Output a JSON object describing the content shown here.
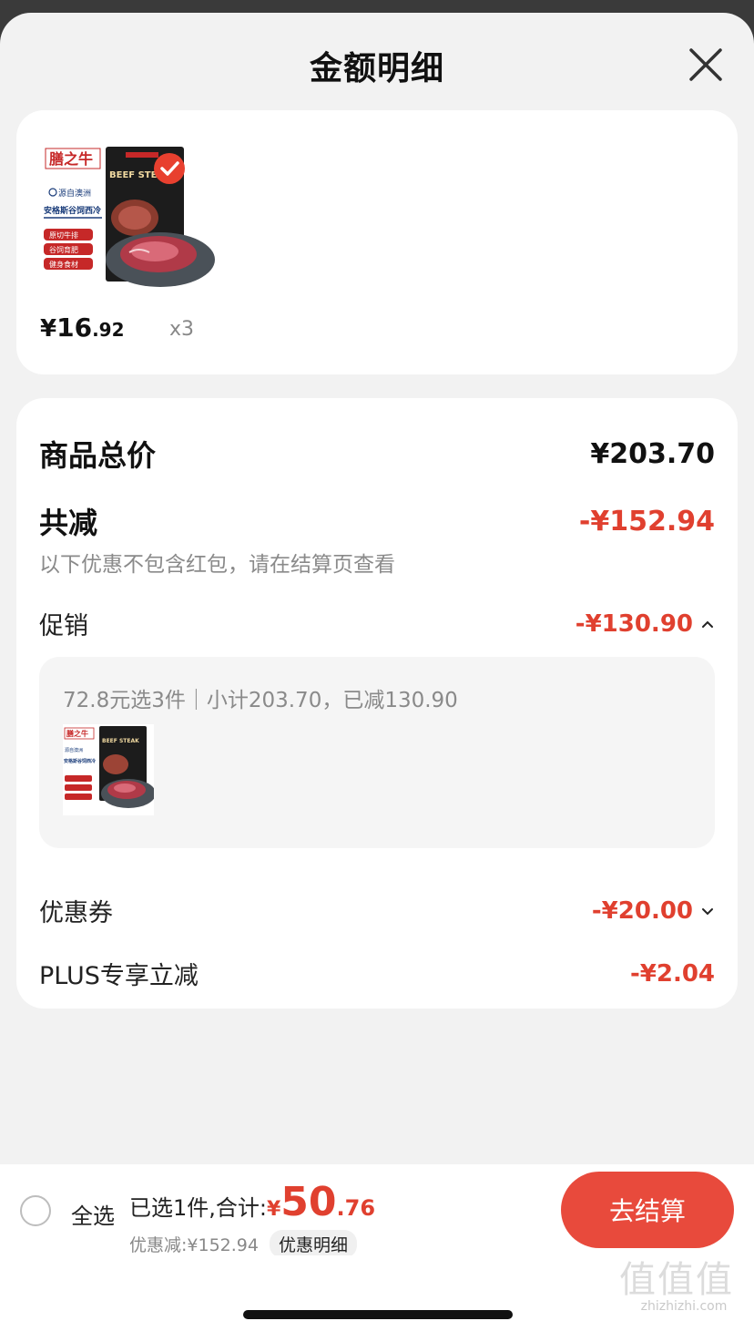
{
  "header": {
    "title": "金额明细"
  },
  "product": {
    "price_currency": "¥",
    "price_int": "16",
    "price_dec": ".92",
    "quantity": "x3",
    "image_texts": {
      "brand": "膳之牛",
      "origin": "源自澳洲",
      "product_name": "安格斯谷饲西冷",
      "tags": [
        "原切牛排",
        "谷饲育肥",
        "健身食材"
      ],
      "package": "BEEF STEAK"
    }
  },
  "detail": {
    "total_label": "商品总价",
    "total_value": "¥203.70",
    "reduce_label": "共减",
    "reduce_value": "-¥152.94",
    "note": "以下优惠不包含红包，请在结算页查看",
    "promo_label": "促销",
    "promo_value": "-¥130.90",
    "promo_desc": "72.8元选3件｜小计203.70，已减130.90",
    "coupon_label": "优惠券",
    "coupon_value": "-¥20.00",
    "plus_label": "PLUS专享立减",
    "plus_value": "-¥2.04"
  },
  "bottom": {
    "select_all": "全选",
    "selected_text": "已选1件,合计:",
    "total_currency": "¥",
    "total_int": "50",
    "total_dec": ".76",
    "discount_text": "优惠减:¥152.94",
    "detail_link": "优惠明细",
    "checkout": "去结算"
  },
  "watermark": {
    "glyphs": "值值值",
    "text": "zhizhizhi.com"
  },
  "colors": {
    "accent_red": "#e0402f",
    "button_red": "#e84a3c",
    "background": "#f2f2f2"
  }
}
